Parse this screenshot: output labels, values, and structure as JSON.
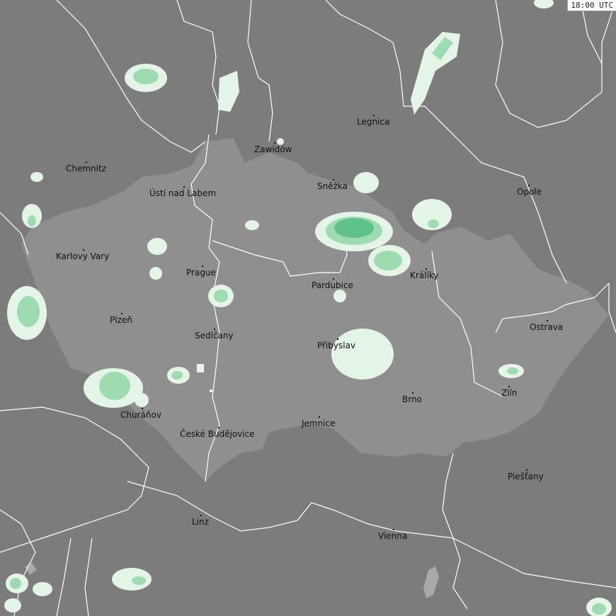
{
  "time_label": "18:00 UTC",
  "colors": {
    "background": "#7c7c7c",
    "country_region": "#8e8e8e",
    "border_line": "#ffffff",
    "lake": "#a9a9a9",
    "precip_light": "#e4f4e6",
    "precip_medium": "#9ddcb1",
    "precip_strong": "#5fc28a"
  },
  "cities": [
    {
      "name": "Chemnitz"
    },
    {
      "name": "Legnica"
    },
    {
      "name": "Zawidów"
    },
    {
      "name": "Ústí nad Labem"
    },
    {
      "name": "Sněžka"
    },
    {
      "name": "Opole"
    },
    {
      "name": "Karlovy Vary"
    },
    {
      "name": "Prague"
    },
    {
      "name": "Pardubice"
    },
    {
      "name": "Králíky"
    },
    {
      "name": "Plzeň"
    },
    {
      "name": "Ostrava"
    },
    {
      "name": "Sedlčany"
    },
    {
      "name": "Přibyslav"
    },
    {
      "name": "Zlín"
    },
    {
      "name": "Brno"
    },
    {
      "name": "Churáňov"
    },
    {
      "name": "České Budějovice"
    },
    {
      "name": "Jemnice"
    },
    {
      "name": "Piešťany"
    },
    {
      "name": "Linz"
    },
    {
      "name": "Vienna"
    }
  ]
}
